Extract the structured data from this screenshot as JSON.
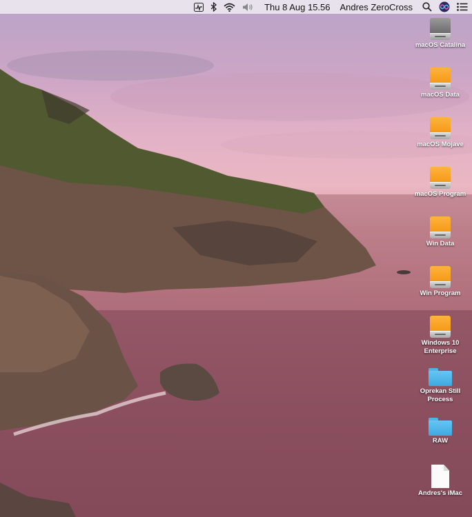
{
  "menubar": {
    "status_items": [
      "activity-monitor-icon",
      "bluetooth-icon",
      "wifi-icon",
      "volume-icon"
    ],
    "datetime": "Thu 8 Aug  15.56",
    "user": "Andres ZeroCross",
    "trailing_items": [
      "spotlight-search-icon",
      "siri-icon",
      "notification-center-icon"
    ]
  },
  "desktop": {
    "items": [
      {
        "label": "macOS Catalina",
        "icon": "internal-drive-icon"
      },
      {
        "label": "macOS Data",
        "icon": "external-drive-icon"
      },
      {
        "label": "macOS Mojave",
        "icon": "external-drive-icon"
      },
      {
        "label": "macOS Program",
        "icon": "external-drive-icon"
      },
      {
        "label": "Win Data",
        "icon": "external-drive-icon"
      },
      {
        "label": "Win Program",
        "icon": "external-drive-icon"
      },
      {
        "label": "Windows 10 Enterprise",
        "icon": "external-drive-icon"
      },
      {
        "label": "Oprekan Still Process",
        "icon": "folder-icon"
      },
      {
        "label": "RAW",
        "icon": "folder-icon"
      },
      {
        "label": "Andres's iMac",
        "icon": "document-icon"
      }
    ]
  }
}
